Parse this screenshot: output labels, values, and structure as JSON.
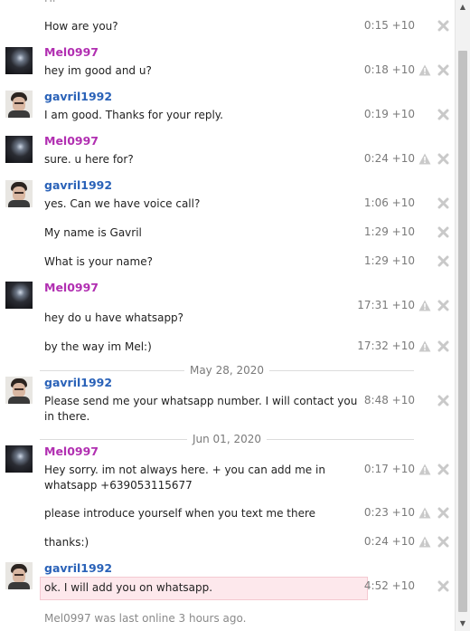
{
  "messages": [
    {
      "sender": "",
      "text": "How are you?",
      "time": "0:15 +10"
    },
    {
      "sender": "Mel0997",
      "text": "hey im good and u?",
      "time": "0:18 +10"
    },
    {
      "sender": "gavril1992",
      "text": "I am good. Thanks for your reply.",
      "time": "0:19 +10"
    },
    {
      "sender": "Mel0997",
      "text": "sure. u here for?",
      "time": "0:24 +10"
    },
    {
      "sender": "gavril1992",
      "text": "yes.  Can we have voice call?",
      "time": "1:06 +10"
    },
    {
      "sender": "",
      "text": "My name is Gavril",
      "time": "1:29 +10"
    },
    {
      "sender": "",
      "text": "What is your name?",
      "time": "1:29 +10"
    },
    {
      "sender": "Mel0997",
      "text": "hey do u have whatsapp?",
      "time": "17:31 +10"
    },
    {
      "sender": "",
      "text": "by the way im Mel:)",
      "time": "17:32 +10"
    },
    {
      "sender": "gavril1992",
      "text": "Please send me your whatsapp number. I will contact you in there.",
      "time": "8:48 +10"
    },
    {
      "sender": "Mel0997",
      "text": "Hey sorry. im not always here. + you can add me in whatsapp +639053115677",
      "time": "0:17 +10"
    },
    {
      "sender": "",
      "text": "please introduce yourself when you text me there",
      "time": "0:23 +10"
    },
    {
      "sender": "",
      "text": "thanks:)",
      "time": "0:24 +10"
    },
    {
      "sender": "gavril1992",
      "text": "ok. I will add you on whatsapp.",
      "time": "4:52 +10"
    }
  ],
  "date_separators": [
    "May 28, 2020",
    "Jun 01, 2020"
  ],
  "status": {
    "last_online": "Mel0997 was last online 3 hours ago."
  },
  "colors": {
    "mel": "#b12fb1",
    "gavril": "#2a62b8",
    "highlight": "#fde8ec"
  },
  "icons": {
    "report": "warning-icon",
    "delete": "close-icon"
  }
}
